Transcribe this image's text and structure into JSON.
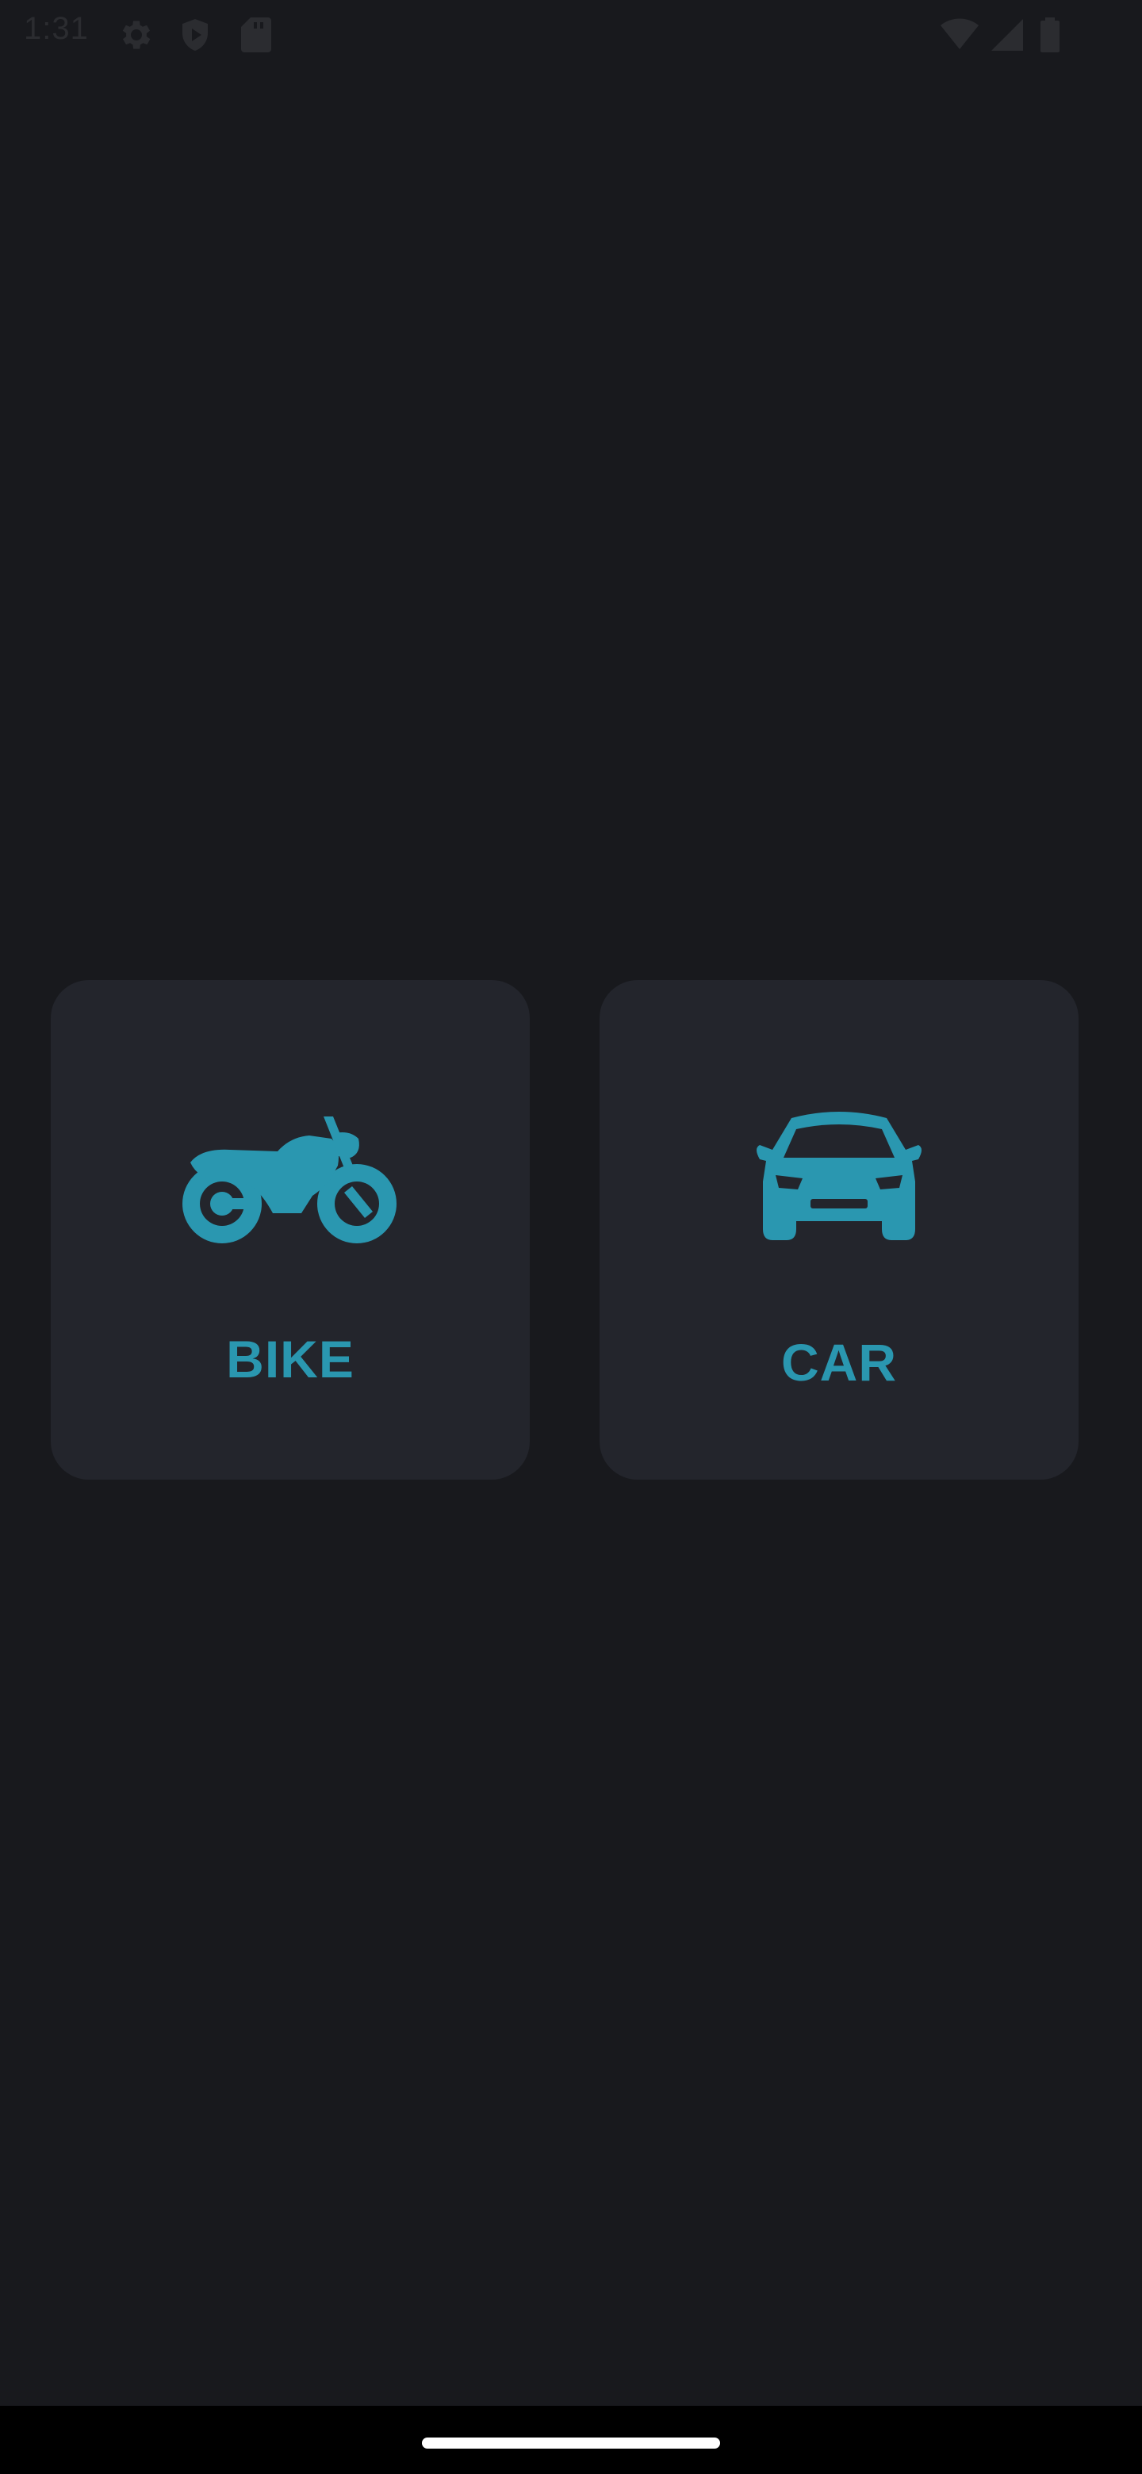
{
  "status_bar": {
    "time": "1:31",
    "icon_color": "#2b2c30",
    "icons": [
      "settings-icon",
      "shield-play-icon",
      "sd-card-icon",
      "wifi-icon",
      "cell-signal-icon",
      "battery-icon"
    ]
  },
  "vehicle_options": [
    {
      "label": "BIKE",
      "icon": "motorcycle-icon"
    },
    {
      "label": "CAR",
      "icon": "car-icon"
    }
  ],
  "colors": {
    "background": "#18191d",
    "card": "#23252c",
    "accent": "#2a97b0",
    "nav_bar": "#000000"
  }
}
